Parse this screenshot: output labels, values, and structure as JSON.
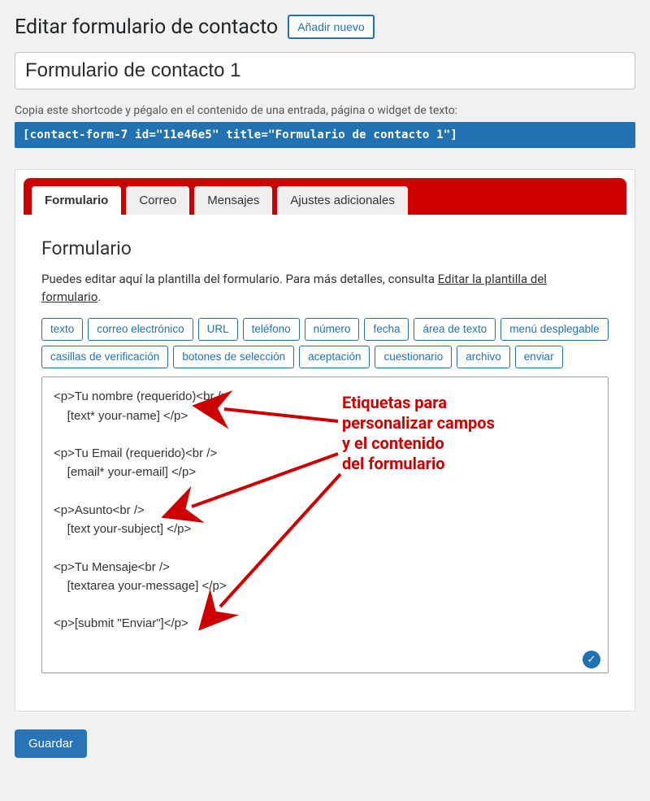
{
  "header": {
    "title": "Editar formulario de contacto",
    "add_new": "Añadir nuevo"
  },
  "form_title_value": "Formulario de contacto 1",
  "shortcode_hint": "Copia este shortcode y pégalo en el contenido de una entrada, página o widget de texto:",
  "shortcode": "[contact-form-7 id=\"11e46e5\" title=\"Formulario de contacto 1\"]",
  "tabs": [
    {
      "label": "Formulario",
      "active": true
    },
    {
      "label": "Correo",
      "active": false
    },
    {
      "label": "Mensajes",
      "active": false
    },
    {
      "label": "Ajustes adicionales",
      "active": false
    }
  ],
  "section": {
    "title": "Formulario",
    "desc_prefix": "Puedes editar aquí la plantilla del formulario. Para más detalles, consulta ",
    "desc_link": "Editar la plantilla del formulario",
    "desc_suffix": "."
  },
  "tag_buttons": [
    "texto",
    "correo electrónico",
    "URL",
    "teléfono",
    "número",
    "fecha",
    "área de texto",
    "menú desplegable",
    "casillas de verificación",
    "botones de selección",
    "aceptación",
    "cuestionario",
    "archivo",
    "enviar"
  ],
  "template_text": "<p>Tu nombre (requerido)<br />\n    [text* your-name] </p>\n\n<p>Tu Email (requerido)<br />\n    [email* your-email] </p>\n\n<p>Asunto<br />\n    [text your-subject] </p>\n\n<p>Tu Mensaje<br />\n    [textarea your-message] </p>\n\n<p>[submit \"Enviar\"]</p>",
  "save_label": "Guardar",
  "annotation": {
    "line1": "Etiquetas para",
    "line2": "personalizar campos",
    "line3": "y el contenido",
    "line4": "del formulario"
  },
  "colors": {
    "accent": "#2271b1",
    "red": "#cc0000"
  }
}
